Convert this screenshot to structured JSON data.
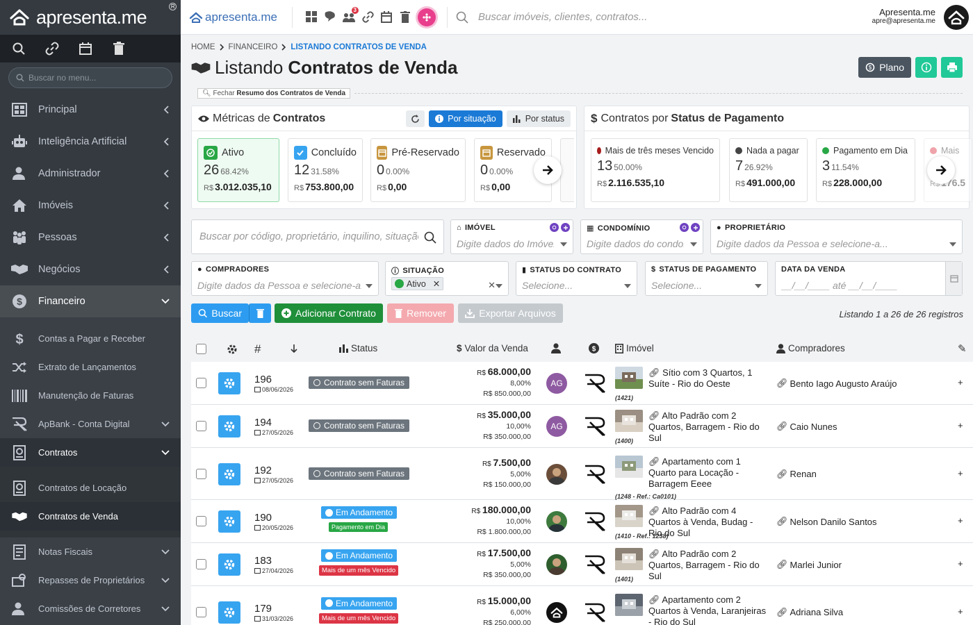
{
  "sidebar": {
    "logo": "apresenta.me",
    "search_placeholder": "Buscar no menu...",
    "nav": [
      {
        "label": "Principal"
      },
      {
        "label": "Inteligência Artificial"
      },
      {
        "label": "Administrador"
      },
      {
        "label": "Imóveis"
      },
      {
        "label": "Pessoas"
      },
      {
        "label": "Negócios"
      },
      {
        "label": "Financeiro"
      }
    ],
    "financeiro_sub": [
      {
        "label": "Contas a Pagar e Receber"
      },
      {
        "label": "Extrato de Lançamentos"
      },
      {
        "label": "Manutenção de Faturas"
      },
      {
        "label": "ApBank - Conta Digital"
      },
      {
        "label": "Contratos"
      }
    ],
    "contratos_sub": [
      {
        "label": "Contratos de Locação"
      },
      {
        "label": "Contratos de Venda"
      }
    ],
    "after": [
      {
        "label": "Notas Fiscais"
      },
      {
        "label": "Repasses de Proprietários"
      },
      {
        "label": "Comissões de Corretores"
      }
    ]
  },
  "topbar": {
    "brand": "apresenta.me",
    "chat_badge": "3",
    "search_placeholder": "Buscar imóveis, clientes, contratos...",
    "user_name": "Apresenta.me",
    "user_email": "apre@apresenta.me"
  },
  "breadcrumb": {
    "home": "HOME",
    "financeiro": "FINANCEIRO",
    "current": "LISTANDO CONTRATOS DE VENDA"
  },
  "page": {
    "title_prefix": "Listando",
    "title_bold": "Contratos de Venda",
    "plano_label": "Plano",
    "resume_prefix": "Fechar",
    "resume_bold": "Resumo dos Contratos de Venda"
  },
  "metrics": {
    "title_prefix": "Métricas de",
    "title_bold": "Contratos",
    "by_situation": "Por situação",
    "by_status": "Por status",
    "items": [
      {
        "label": "Ativo",
        "count": "26",
        "pct": "68.42%",
        "cur": "R$",
        "value": "3.012.035,10",
        "color": "#28a745"
      },
      {
        "label": "Concluído",
        "count": "12",
        "pct": "31.58%",
        "cur": "R$",
        "value": "753.800,00",
        "color": "#37a4f0"
      },
      {
        "label": "Pré-Reservado",
        "count": "0",
        "pct": "0.00%",
        "cur": "R$",
        "value": "0,00",
        "color": "#c8963e"
      },
      {
        "label": "Reservado",
        "count": "0",
        "pct": "0.00%",
        "cur": "R$",
        "value": "0,00",
        "color": "#c8963e"
      }
    ]
  },
  "payments": {
    "title_prefix": "Contratos por",
    "title_bold": "Status de Pagamento",
    "items": [
      {
        "label": "Mais de três meses Vencido",
        "count": "13",
        "pct": "50.00%",
        "cur": "R$",
        "value": "2.116.535,10",
        "color": "#a61c1c"
      },
      {
        "label": "Nada a pagar",
        "count": "7",
        "pct": "26.92%",
        "cur": "R$",
        "value": "491.000,00",
        "color": "#444"
      },
      {
        "label": "Pagamento em Dia",
        "count": "3",
        "pct": "11.54%",
        "cur": "R$",
        "value": "228.000,00",
        "color": "#28a745"
      },
      {
        "label": "Mais",
        "count": "",
        "pct": "",
        "cur": "R$",
        "value": "176.5",
        "color": "#dc3545"
      }
    ]
  },
  "filters": {
    "search_placeholder": "Buscar por código, proprietário, inquilino, situação...",
    "imovel_label": "IMÓVEL",
    "imovel_ph": "Digite dados do Imóvel...",
    "condominio_label": "CONDOMÍNIO",
    "condominio_ph": "Digite dados do condomínio...",
    "proprietario_label": "PROPRIETÁRIO",
    "proprietario_ph": "Digite dados da Pessoa e selecione-a...",
    "compradores_label": "COMPRADORES",
    "compradores_ph": "Digite dados da Pessoa e selecione-a...",
    "situacao_label": "SITUAÇÃO",
    "situacao_chip": "Ativo",
    "status_contrato_label": "STATUS DO CONTRATO",
    "status_pag_label": "STATUS DE PAGAMENTO",
    "select_ph": "Selecione...",
    "data_venda_label": "DATA DA VENDA",
    "date_from": "__/__/____",
    "date_sep": "até",
    "date_to": "__/__/____"
  },
  "actions": {
    "search": "Buscar",
    "add": "Adicionar Contrato",
    "remove": "Remover",
    "export": "Exportar Arquivos",
    "listing": "Listando 1 a 26 de 26 registros"
  },
  "table": {
    "headers": {
      "id": "#",
      "status": "Status",
      "value": "Valor da Venda",
      "property": "Imóvel",
      "buyers": "Compradores"
    },
    "rows": [
      {
        "id": "196",
        "date": "08/06/2026",
        "status": "Contrato sem Faturas",
        "status_type": "dark",
        "pay": "",
        "value": "68.000,00",
        "pct": "8,00%",
        "total": "R$ 850.000,00",
        "avatar": "AG",
        "av_type": "ag",
        "title": "Sítio com 3 Quartos, 1 Suíte - Rio do Oeste",
        "code": "(1421)",
        "buyer": "Bento Iago Augusto Araújo"
      },
      {
        "id": "194",
        "date": "27/05/2026",
        "status": "Contrato sem Faturas",
        "status_type": "dark",
        "pay": "",
        "value": "35.000,00",
        "pct": "10,00%",
        "total": "R$ 350.000,00",
        "avatar": "AG",
        "av_type": "ag",
        "title": "Alto Padrão com 2 Quartos, Barragem - Rio do Sul",
        "code": "(1400)",
        "buyer": "Caio Nunes"
      },
      {
        "id": "192",
        "date": "27/05/2026",
        "status": "Contrato sem Faturas",
        "status_type": "dark",
        "pay": "",
        "value": "7.500,00",
        "pct": "5,00%",
        "total": "R$ 150.000,00",
        "avatar": "",
        "av_type": "ph",
        "title": "Apartamento com 1 Quarto para Locação - Barragem Eeee",
        "code": "(1248 - Ref.: Ca0101)",
        "buyer": "Renan"
      },
      {
        "id": "190",
        "date": "20/05/2026",
        "status": "Em Andamento",
        "status_type": "blue",
        "pay": "Pagamento em Dia",
        "pay_type": "green",
        "value": "180.000,00",
        "pct": "10,00%",
        "total": "R$ 1.800.000,00",
        "avatar": "",
        "av_type": "ph",
        "title": "Alto Padrão com 4 Quartos à Venda, Budag - Rio do Sul",
        "code": "(1410 - Ref.: 1238)",
        "buyer": "Nelson Danilo Santos"
      },
      {
        "id": "183",
        "date": "27/04/2026",
        "status": "Em Andamento",
        "status_type": "blue",
        "pay": "Mais de um mês Vencido",
        "pay_type": "red",
        "value": "17.500,00",
        "pct": "5,00%",
        "total": "R$ 350.000,00",
        "avatar": "",
        "av_type": "ph",
        "title": "Alto Padrão com 2 Quartos, Barragem - Rio do Sul",
        "code": "(1401)",
        "buyer": "Marlei Junior"
      },
      {
        "id": "179",
        "date": "31/03/2026",
        "status": "Em Andamento",
        "status_type": "blue",
        "pay": "Mais de um mês Vencido",
        "pay_type": "red",
        "value": "15.000,00",
        "pct": "6,00%",
        "total": "R$ 250.000,00",
        "avatar": "",
        "av_type": "black",
        "title": "Apartamento com 2 Quartos à Venda, Laranjeiras - Rio do Sul",
        "code": "",
        "buyer": "Adriana Silva"
      }
    ]
  }
}
